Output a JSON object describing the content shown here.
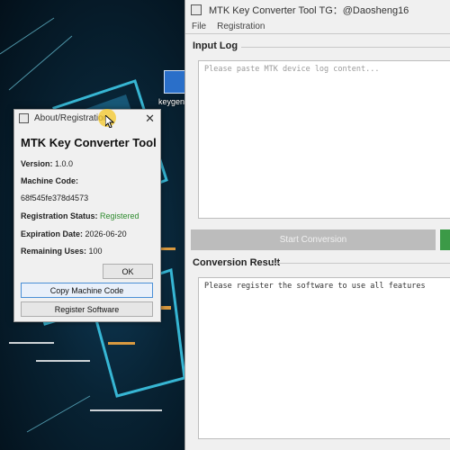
{
  "desktop": {
    "icon_label": "keygen-"
  },
  "main_window": {
    "title": "MTK Key Converter Tool   TG：@Daosheng16",
    "menu": [
      "File",
      "Registration"
    ],
    "input_section_label": "Input Log",
    "input_placeholder": "Please paste MTK device log content...",
    "start_button_label": "Start Conversion",
    "result_section_label": "Conversion Result",
    "result_text": "Please register the software to use all features"
  },
  "dialog": {
    "title": "About/Registration",
    "heading": "MTK Key Converter Tool",
    "version_label": "Version:",
    "version_value": "1.0.0",
    "machine_code_label": "Machine Code:",
    "machine_code_value": "68f545fe378d4573",
    "reg_status_label": "Registration Status:",
    "reg_status_value": "Registered",
    "expiration_label": "Expiration Date:",
    "expiration_value": "2026-06-20",
    "remaining_label": "Remaining Uses:",
    "remaining_value": "100",
    "ok_label": "OK",
    "copy_label": "Copy Machine Code",
    "register_label": "Register Software"
  },
  "colors": {
    "status_registered": "#2e8b2e",
    "accent_green": "#3c9a47"
  }
}
